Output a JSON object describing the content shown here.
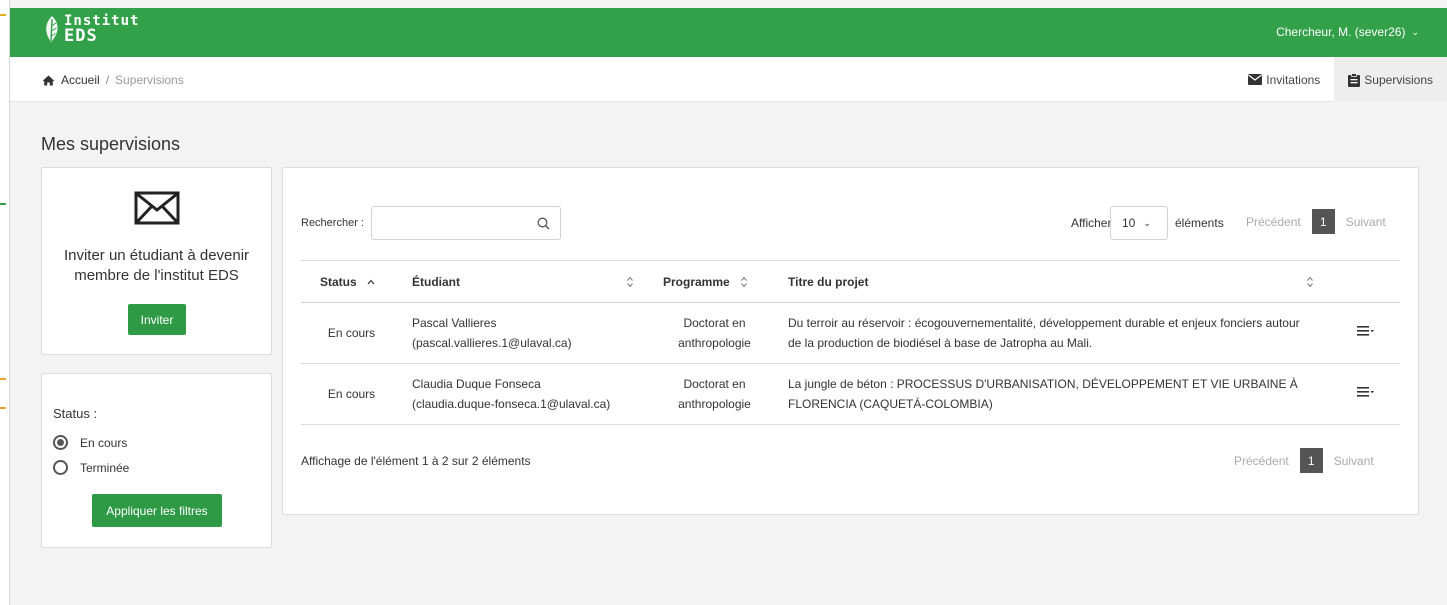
{
  "app": {
    "logo_line1": "Institut",
    "logo_line2": "EDS",
    "user": "Chercheur, M. (sever26)"
  },
  "breadcrumb": {
    "home": "Accueil",
    "separator": "/",
    "current": "Supervisions"
  },
  "nav": {
    "invitations": "Invitations",
    "supervisions": "Supervisions"
  },
  "page": {
    "title": "Mes supervisions"
  },
  "invite": {
    "text": "Inviter un étudiant à devenir membre de l'institut EDS",
    "button": "Inviter"
  },
  "filters": {
    "label": "Status :",
    "options": [
      {
        "label": "En cours",
        "checked": true
      },
      {
        "label": "Terminée",
        "checked": false
      }
    ],
    "apply": "Appliquer les filtres"
  },
  "table": {
    "search_label": "Rechercher :",
    "search_value": "",
    "show_label": "Afficher",
    "page_size": "10",
    "elements_label": "éléments",
    "prev": "Précédent",
    "next": "Suivant",
    "page": "1",
    "columns": {
      "status": "Status",
      "student": "Étudiant",
      "program": "Programme",
      "title": "Titre du projet"
    },
    "rows": [
      {
        "status": "En cours",
        "student_name": "Pascal Vallieres",
        "student_email": "(pascal.vallieres.1@ulaval.ca)",
        "program_l1": "Doctorat en",
        "program_l2": "anthropologie",
        "title": "Du terroir au réservoir : écogouvernementalité, développement durable et enjeux fonciers autour de la production de biodiésel à base de Jatropha au Mali."
      },
      {
        "status": "En cours",
        "student_name": "Claudia Duque Fonseca",
        "student_email": "(claudia.duque-fonseca.1@ulaval.ca)",
        "program_l1": "Doctorat en",
        "program_l2": "anthropologie",
        "title": "La jungle de béton : PROCESSUS D'URBANISATION, DÉVELOPPEMENT ET VIE URBAINE À FLORENCIA (CAQUETÁ-COLOMBIA)"
      }
    ],
    "info": "Affichage de l'élément 1 à 2 sur 2 éléments"
  },
  "colors": {
    "brand_green": "#33a04a",
    "button_green": "#2f9a46",
    "pager_active": "#555555"
  }
}
